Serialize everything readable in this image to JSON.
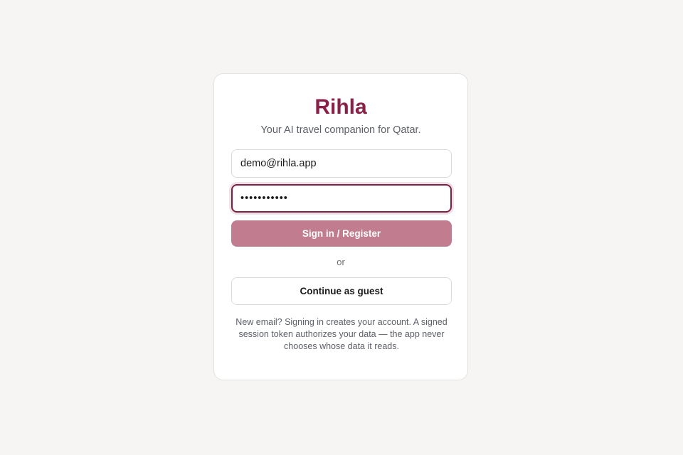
{
  "app": {
    "title": "Rihla",
    "subtitle": "Your AI travel companion for Qatar."
  },
  "form": {
    "email_value": "demo@rihla.app",
    "password_value": "***********",
    "submit_label": "Sign in / Register",
    "divider_text": "or",
    "guest_label": "Continue as guest",
    "note": "New email? Signing in creates your account. A signed session token authorizes your data — the app never chooses whose data it reads."
  },
  "colors": {
    "brand": "#8a1f47",
    "button": "#c17d8f",
    "focus_border": "#7e1e45",
    "background": "#f6f5f3"
  }
}
